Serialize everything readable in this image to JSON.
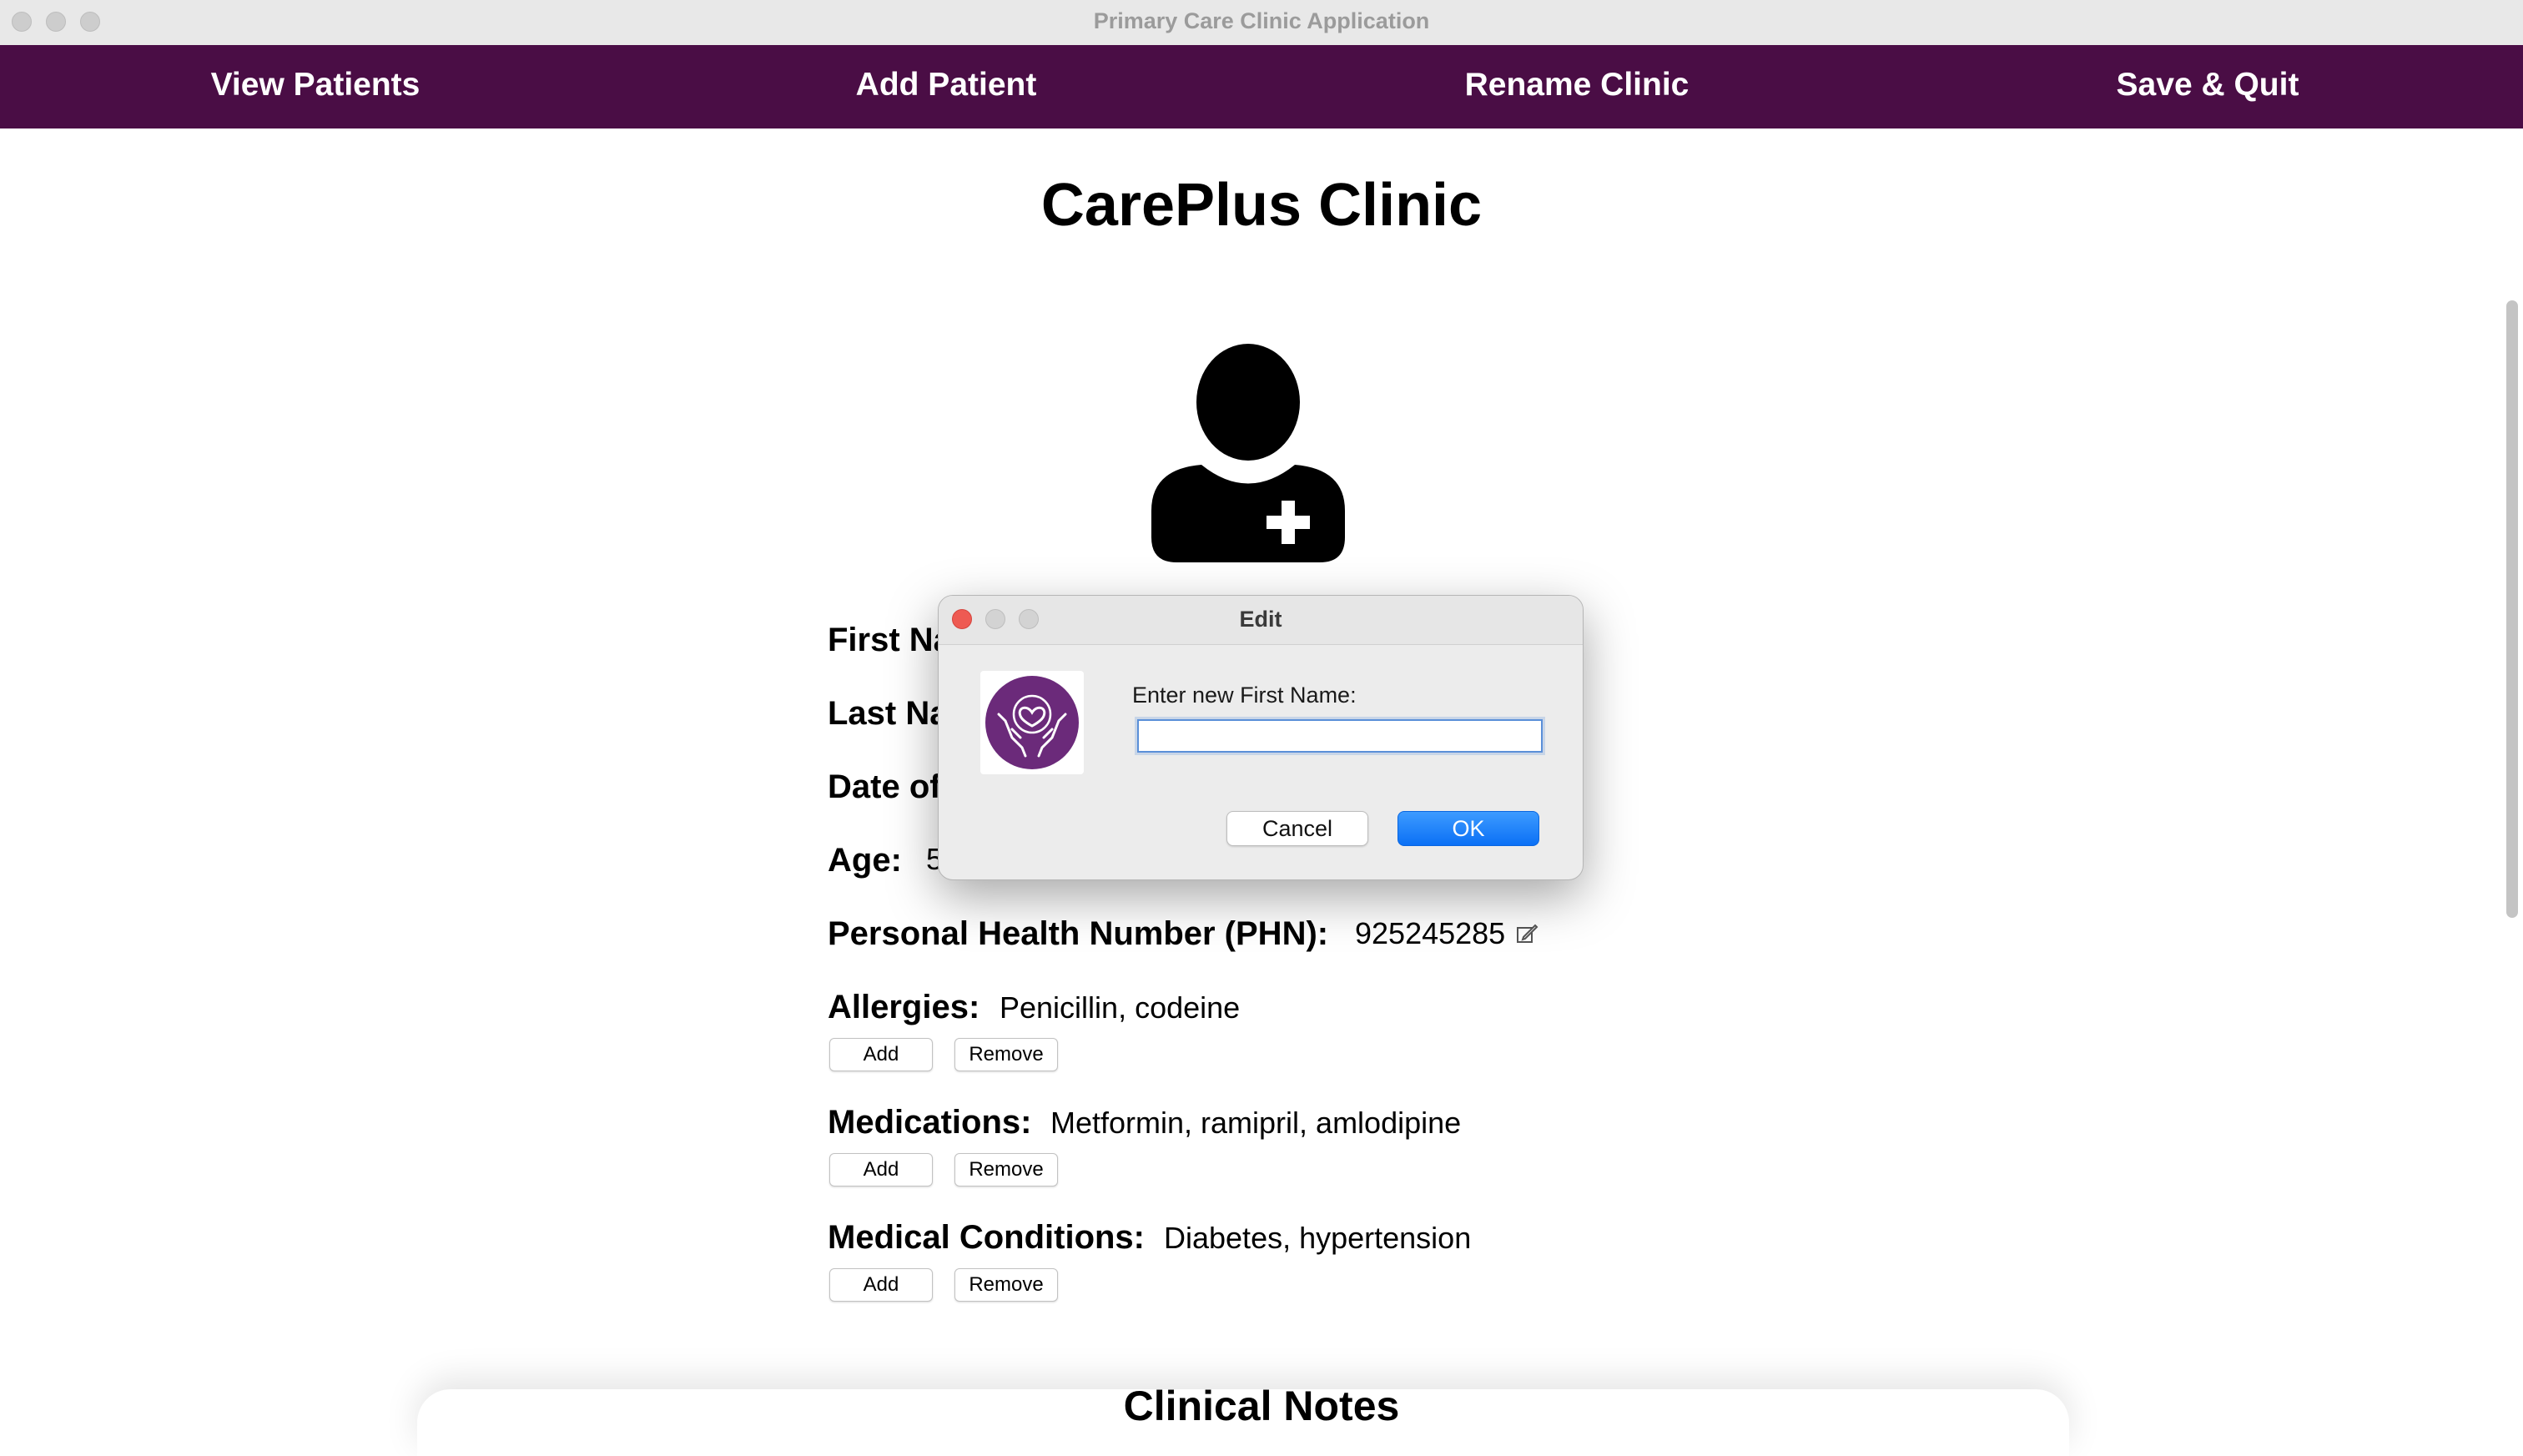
{
  "window": {
    "title": "Primary Care Clinic Application"
  },
  "nav": {
    "items": [
      {
        "label": "View Patients"
      },
      {
        "label": "Add Patient"
      },
      {
        "label": "Rename Clinic"
      },
      {
        "label": "Save & Quit"
      }
    ]
  },
  "clinic": {
    "name": "CarePlus Clinic"
  },
  "patient": {
    "first_name_label": "First Na",
    "last_name_label": "Last Na",
    "dob_label": "Date of",
    "age_label": "Age:",
    "age_value_partial": "5",
    "phn_label": "Personal Health Number (PHN):",
    "phn_value": "925245285",
    "allergies_label": "Allergies:",
    "allergies_value": "Penicillin, codeine",
    "medications_label": "Medications:",
    "medications_value": "Metformin, ramipril, amlodipine",
    "conditions_label": "Medical Conditions:",
    "conditions_value": "Diabetes, hypertension"
  },
  "list_buttons": {
    "add": "Add",
    "remove": "Remove"
  },
  "notes": {
    "title": "Clinical Notes"
  },
  "dialog": {
    "title": "Edit",
    "prompt": "Enter new First Name:",
    "input_value": "",
    "cancel_label": "Cancel",
    "ok_label": "OK"
  },
  "colors": {
    "nav_bg": "#4a0d45",
    "logo_purple": "#6b2a7a",
    "ok_blue": "#0b70f5"
  },
  "icons": [
    "user-plus-icon",
    "edit-pencil-icon",
    "heart-hands-logo-icon"
  ]
}
